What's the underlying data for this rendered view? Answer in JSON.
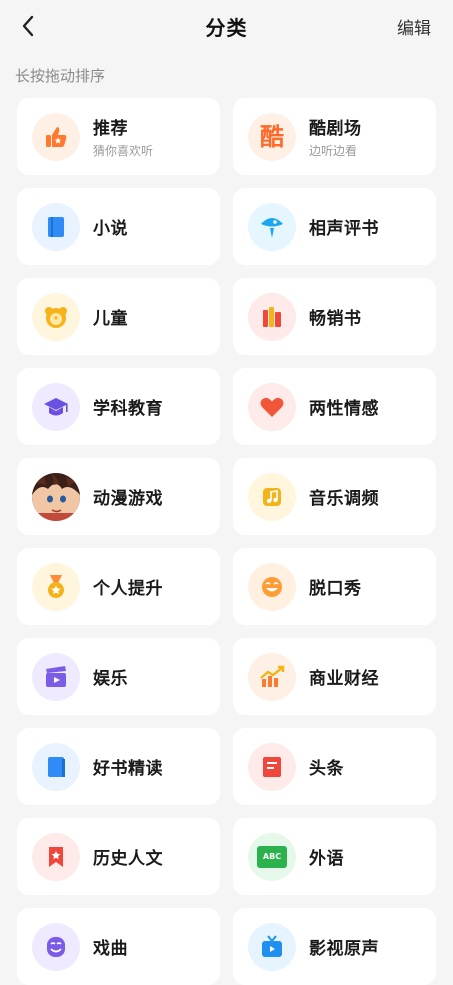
{
  "header": {
    "title": "分类",
    "edit_label": "编辑"
  },
  "hint": "长按拖动排序",
  "categories": [
    {
      "title": "推荐",
      "subtitle": "猜你喜欢听",
      "icon": "thumbs-up-icon",
      "tint": "#fff0e6",
      "color": "#ff7a2e"
    },
    {
      "title": "酷剧场",
      "subtitle": "边听边看",
      "icon": "theater-icon",
      "tint": "#fff0e6",
      "color": "#ff6a2a",
      "glyph": "酷"
    },
    {
      "title": "小说",
      "icon": "book-icon",
      "tint": "#e8f3ff",
      "color": "#2f8bf5"
    },
    {
      "title": "相声评书",
      "icon": "fan-icon",
      "tint": "#e6f6ff",
      "color": "#1aa7ec"
    },
    {
      "title": "儿童",
      "icon": "bear-icon",
      "tint": "#fff6dd",
      "color": "#f7b21a"
    },
    {
      "title": "畅销书",
      "icon": "bookshelf-icon",
      "tint": "#ffeaea",
      "color": "#f0473c"
    },
    {
      "title": "学科教育",
      "icon": "graduation-cap-icon",
      "tint": "#efeaff",
      "color": "#6b4fe0"
    },
    {
      "title": "两性情感",
      "icon": "heart-icon",
      "tint": "#ffeaea",
      "color": "#f0563a"
    },
    {
      "title": "动漫游戏",
      "icon": "anime-character-avatar-icon",
      "tint": "#3b2a2a",
      "color": "#c14a3a"
    },
    {
      "title": "音乐调频",
      "icon": "music-note-icon",
      "tint": "#fff6dd",
      "color": "#f5b31a"
    },
    {
      "title": "个人提升",
      "icon": "medal-icon",
      "tint": "#fff6dd",
      "color": "#f5b31a"
    },
    {
      "title": "脱口秀",
      "icon": "laughing-face-icon",
      "tint": "#fff0e2",
      "color": "#ff9c33"
    },
    {
      "title": "娱乐",
      "icon": "clapperboard-icon",
      "tint": "#efeaff",
      "color": "#7b5ce6"
    },
    {
      "title": "商业财经",
      "icon": "trend-chart-icon",
      "tint": "#fff0e6",
      "color": "#ff7a2e"
    },
    {
      "title": "好书精读",
      "icon": "blue-book-icon",
      "tint": "#e8f3ff",
      "color": "#2f8bf5"
    },
    {
      "title": "头条",
      "icon": "newspaper-icon",
      "tint": "#ffeaea",
      "color": "#f0473c"
    },
    {
      "title": "历史人文",
      "icon": "bookmark-star-icon",
      "tint": "#ffeaea",
      "color": "#f0473c"
    },
    {
      "title": "外语",
      "icon": "abc-board-icon",
      "tint": "#e6f8ea",
      "color": "#2bb24c",
      "glyph": "ABC"
    },
    {
      "title": "戏曲",
      "icon": "opera-mask-icon",
      "tint": "#efeaff",
      "color": "#7b5ce6"
    },
    {
      "title": "影视原声",
      "icon": "tv-icon",
      "tint": "#e6f4ff",
      "color": "#1f8ff0"
    }
  ]
}
